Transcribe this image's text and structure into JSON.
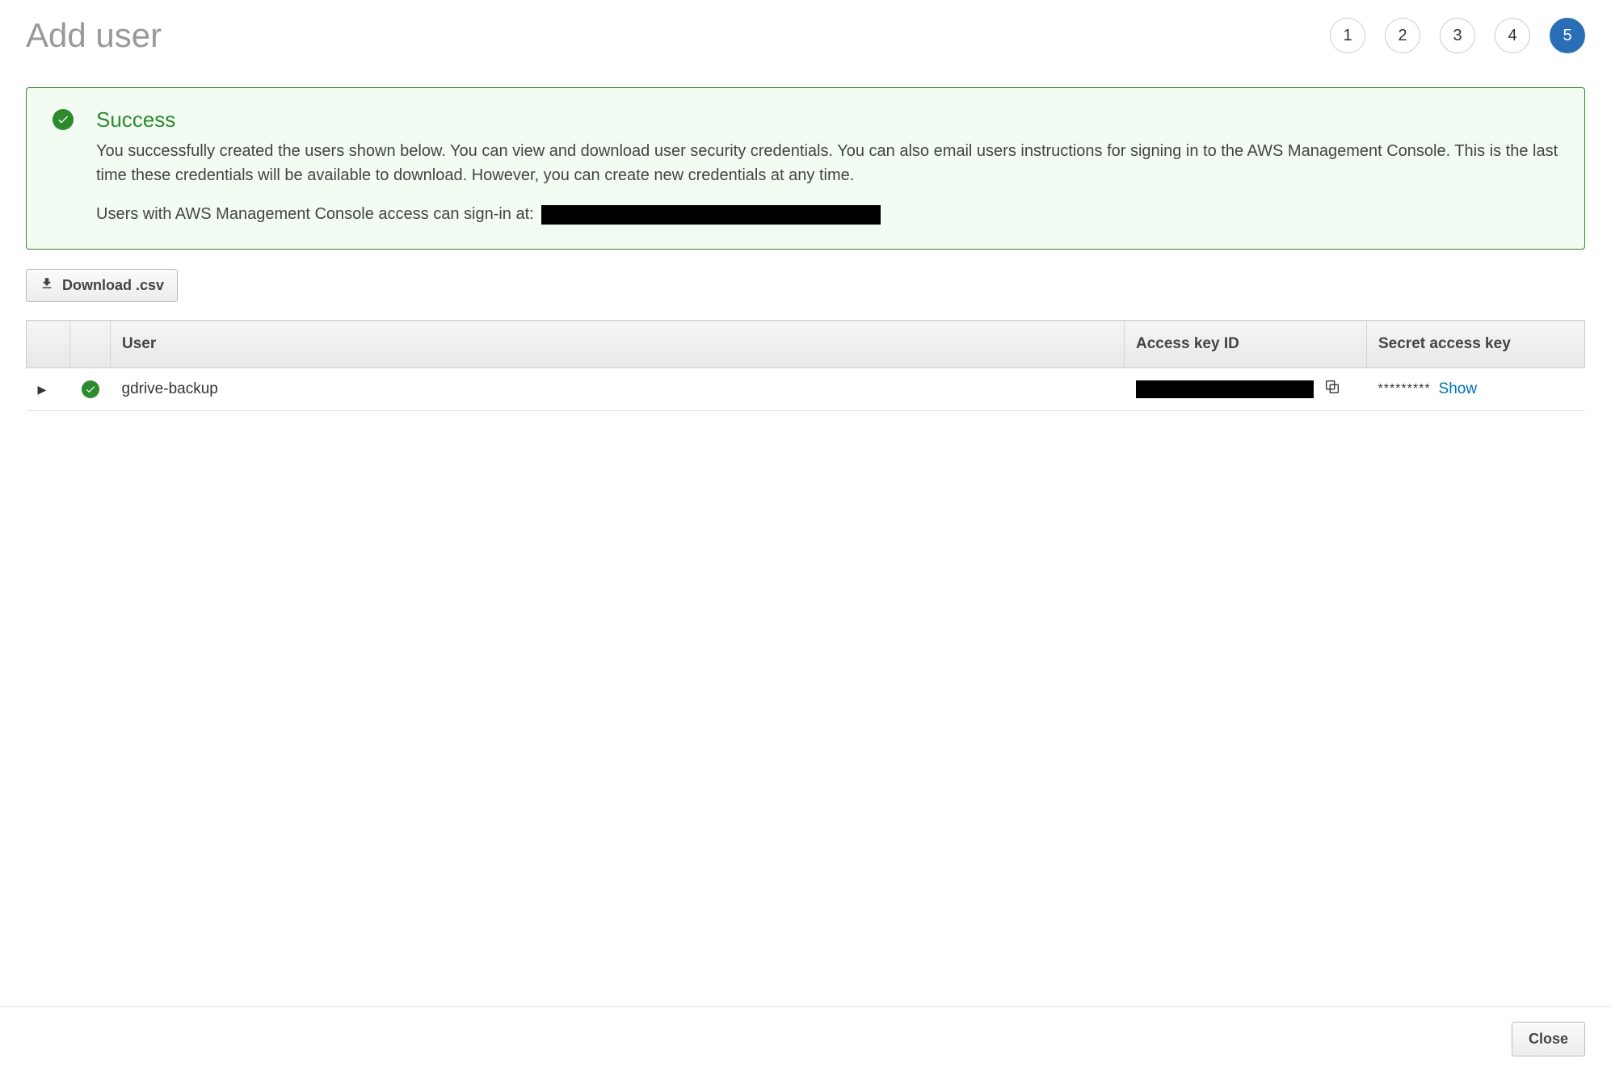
{
  "header": {
    "title": "Add user",
    "steps": [
      "1",
      "2",
      "3",
      "4",
      "5"
    ],
    "activeStep": 5
  },
  "success": {
    "title": "Success",
    "body": "You successfully created the users shown below. You can view and download user security credentials. You can also email users instructions for signing in to the AWS Management Console. This is the last time these credentials will be available to download. However, you can create new credentials at any time.",
    "signinPrefix": "Users with AWS Management Console access can sign-in at:"
  },
  "buttons": {
    "downloadCsv": "Download .csv",
    "close": "Close"
  },
  "table": {
    "headers": {
      "user": "User",
      "accessKey": "Access key ID",
      "secretKey": "Secret access key"
    },
    "rows": [
      {
        "username": "gdrive-backup",
        "secretMasked": "*********",
        "showLabel": "Show"
      }
    ]
  }
}
